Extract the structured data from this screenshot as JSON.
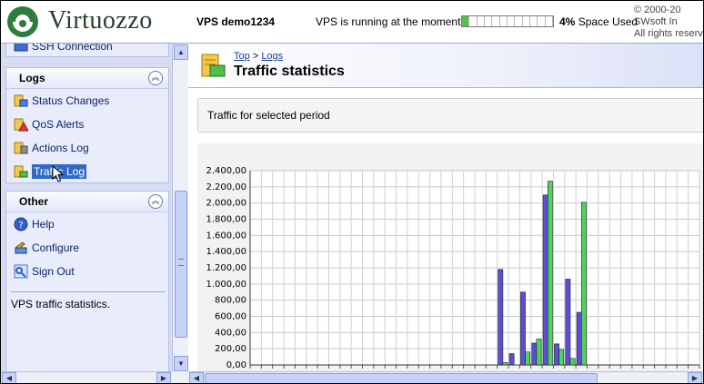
{
  "header": {
    "brand": "Virtuozzo",
    "vps_name": "VPS demo1234",
    "status_text": "VPS is running at the moment",
    "space_percent": "4%",
    "space_label": "Space Used",
    "space_fraction": 0.04,
    "copyright_line1": "© 2000-20",
    "copyright_line2": "SWsoft In",
    "copyright_line3": "All rights reserv"
  },
  "sidebar": {
    "partial_item": "SSH Connection",
    "logs_panel": {
      "title": "Logs",
      "items": [
        {
          "label": "Status Changes"
        },
        {
          "label": "QoS Alerts"
        },
        {
          "label": "Actions Log"
        },
        {
          "label": "Traffic Log"
        }
      ]
    },
    "other_panel": {
      "title": "Other",
      "items": [
        {
          "label": "Help"
        },
        {
          "label": "Configure"
        },
        {
          "label": "Sign Out"
        }
      ]
    },
    "description": "VPS traffic statistics."
  },
  "main": {
    "breadcrumb_top": "Top",
    "breadcrumb_sep": ">",
    "breadcrumb_logs": "Logs",
    "page_title": "Traffic statistics",
    "period_label": "Traffic for selected period"
  },
  "colors": {
    "incoming": "#5b4fd6",
    "outgoing": "#4fd35e",
    "selection": "#316ac5"
  },
  "chart_data": {
    "type": "bar",
    "ylim": [
      0,
      2400
    ],
    "yticks": [
      "0,00",
      "200,00",
      "400,00",
      "600,00",
      "800,00",
      "1.000,00",
      "1.200,00",
      "1.400,00",
      "1.600,00",
      "1.800,00",
      "2.000,00",
      "2.200,00",
      "2.400,00"
    ],
    "grid": true,
    "series": [
      {
        "values": [
          0,
          0,
          0,
          0,
          0,
          0,
          0,
          0,
          0,
          0,
          0,
          0,
          0,
          0,
          0,
          0,
          0,
          0,
          0,
          0,
          0,
          0,
          1180,
          140,
          900,
          270,
          2100,
          260,
          1060,
          650,
          0,
          0,
          0,
          0,
          0,
          0,
          0,
          0,
          0,
          0
        ]
      },
      {
        "values": [
          0,
          0,
          0,
          0,
          0,
          0,
          0,
          0,
          0,
          0,
          0,
          0,
          0,
          0,
          0,
          0,
          0,
          0,
          0,
          0,
          0,
          0,
          30,
          0,
          160,
          320,
          2270,
          190,
          80,
          2010,
          0,
          0,
          0,
          0,
          0,
          0,
          0,
          0,
          0,
          0
        ]
      }
    ]
  }
}
